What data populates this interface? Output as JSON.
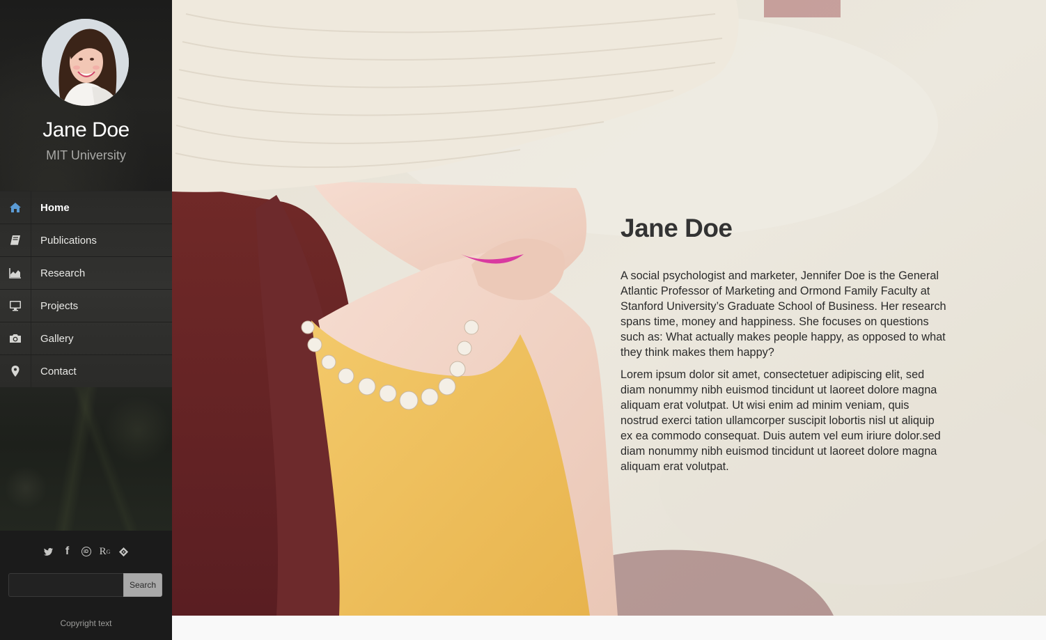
{
  "profile": {
    "name": "Jane Doe",
    "affiliation": "MIT University"
  },
  "nav": {
    "items": [
      {
        "label": "Home",
        "icon": "home-icon",
        "active": true
      },
      {
        "label": "Publications",
        "icon": "book-icon",
        "active": false
      },
      {
        "label": "Research",
        "icon": "area-chart-icon",
        "active": false
      },
      {
        "label": "Projects",
        "icon": "desktop-icon",
        "active": false
      },
      {
        "label": "Gallery",
        "icon": "camera-icon",
        "active": false
      },
      {
        "label": "Contact",
        "icon": "map-marker-icon",
        "active": false
      }
    ]
  },
  "social": {
    "icons": [
      "twitter-icon",
      "facebook-icon",
      "orcid-icon",
      "researchgate-icon",
      "academia-icon"
    ],
    "facebook_glyph": "f",
    "orcid_glyph": "iD",
    "researchgate_glyph": "R",
    "researchgate_sup": "G"
  },
  "search": {
    "placeholder": "",
    "button_label": "Search"
  },
  "copyright": "Copyright text",
  "hero": {
    "title": "Jane Doe",
    "paragraph_1": "A social psychologist and marketer, Jennifer Doe is the General Atlantic Professor of Marketing and Ormond Family Faculty at Stanford University’s Graduate School of Business. Her research spans time, money and happiness. She focuses on questions such as: What actually makes people happy, as opposed to what they think makes them happy?",
    "paragraph_2": "Lorem ipsum dolor sit amet, consectetuer adipiscing elit, sed diam nonummy nibh euismod tincidunt ut laoreet dolore magna aliquam erat volutpat. Ut wisi enim ad minim veniam, quis nostrud exerci tation ullamcorper suscipit lobortis nisl ut aliquip ex ea commodo consequat. Duis autem vel eum iriure dolor.sed diam nonummy nibh euismod tincidunt ut laoreet dolore magna aliquam erat volutpat."
  },
  "colors": {
    "sidebar_bg": "#161616",
    "nav_bg": "#2f2f2d",
    "active_icon": "#5b9bd5",
    "hero_title": "#333333"
  }
}
